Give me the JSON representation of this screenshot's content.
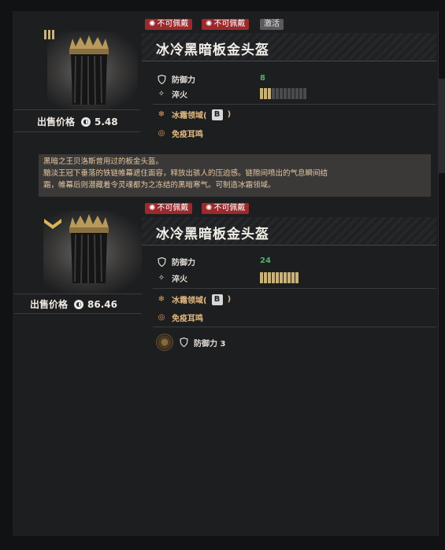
{
  "items": [
    {
      "tags": [
        {
          "label": "不可佩戴",
          "style": "red"
        },
        {
          "label": "不可佩戴",
          "style": "red"
        },
        {
          "label": "激活",
          "style": "grey"
        }
      ],
      "rank_badge": "III",
      "name": "冰冷黑暗板金头盔",
      "stats": [
        {
          "label": "防御力",
          "value": "8",
          "icon": "shield-icon"
        },
        {
          "label": "淬火",
          "bars_filled": 3,
          "bars_total": 12,
          "icon": "tempering-icon"
        }
      ],
      "effects": [
        {
          "label": "冰霜领域(",
          "badge": "B",
          "suffix": ")",
          "icon": "snowflake-icon"
        },
        {
          "label": "免疫耳鸣",
          "icon": "ear-icon"
        }
      ],
      "sell_label": "出售价格",
      "sell_price": "5.48"
    },
    {
      "tags": [
        {
          "label": "不可佩戴",
          "style": "red"
        },
        {
          "label": "不可佩戴",
          "style": "red"
        }
      ],
      "rank_badge": "chevron",
      "name": "冰冷黑暗板金头盔",
      "stats": [
        {
          "label": "防御力",
          "value": "24",
          "icon": "shield-icon"
        },
        {
          "label": "淬火",
          "bars_filled": 10,
          "bars_total": 10,
          "icon": "tempering-icon"
        }
      ],
      "effects": [
        {
          "label": "冰霜领域(",
          "badge": "B",
          "suffix": ")",
          "icon": "snowflake-icon"
        },
        {
          "label": "免疫耳鸣",
          "icon": "ear-icon"
        }
      ],
      "sell_label": "出售价格",
      "sell_price": "86.46",
      "socket": {
        "label": "防御力 3",
        "icon": "gem-socket-icon"
      }
    }
  ],
  "description": {
    "line1": "黑暗之王贝洛斯曾用过的板金头盔。",
    "line2": "黯淡王冠下垂落的铁链帷幕遮住面容，释放出骇人的压迫感。链隙间喷出的气息瞬间结",
    "line3": "霜，帷幕后则潜藏着令灵魂都为之冻结的黑暗寒气。可制造冰霜领域。"
  },
  "colors": {
    "tag_red": "#9c2a2c",
    "green_value": "#4fb06e",
    "effect": "#e0b880",
    "bar_on": "#c9b27a"
  }
}
